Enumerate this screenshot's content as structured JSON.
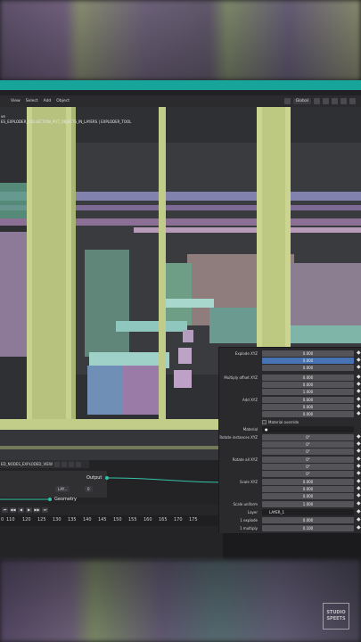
{
  "header": {
    "menu": [
      "View",
      "Select",
      "Add",
      "Object"
    ],
    "orientation": "Global"
  },
  "viewport": {
    "line1": "ve",
    "line2": "ES_EXPLODER_COLLECTION_PUT_OBJECTS_IN_LAYERS | EXPLODER_TOOL"
  },
  "nodes": {
    "tree_name": "ED_NODES_EXPLODED_VIEW",
    "output_label": "Output",
    "geometry_label": "Geometry",
    "layer_tag": "LAY...",
    "layer_num": "0"
  },
  "timeline": {
    "ticks": [
      "0",
      "110",
      "120",
      "125",
      "130",
      "135",
      "140",
      "145",
      "150",
      "155",
      "160",
      "165",
      "170",
      "175"
    ]
  },
  "properties": {
    "explode_label": "Explode XYZ",
    "explode": [
      "0.000",
      "0.000",
      "0.000"
    ],
    "multiply_label": "Multiply offset XYZ",
    "multiply": [
      "0.000",
      "0.000",
      "1.000"
    ],
    "add_label": "Add XYZ",
    "add": [
      "0.000",
      "0.000",
      "0.000"
    ],
    "material_override": "Material override",
    "material_label": "Material",
    "rotate_inst_label": "Rotate instances XYZ",
    "rotate_inst": [
      "0°",
      "0°",
      "0°"
    ],
    "rotate_all_label": "Rotate all XYZ",
    "rotate_all": [
      "0°",
      "0°",
      "0°"
    ],
    "scale_label": "Scale XYZ",
    "scale": [
      "0.000",
      "0.000",
      "0.000"
    ],
    "scale_uniform_label": "Scale uniform",
    "scale_uniform": "1.000",
    "layer_label": "Layer",
    "layer": "LAYER_1",
    "one_explode_label": "1 explode",
    "one_explode": "0.000",
    "one_multiply_label": "1 multiply",
    "one_multiply": "0.100"
  },
  "watermark": {
    "line1": "STUDIO",
    "line2": "SPEETS"
  }
}
